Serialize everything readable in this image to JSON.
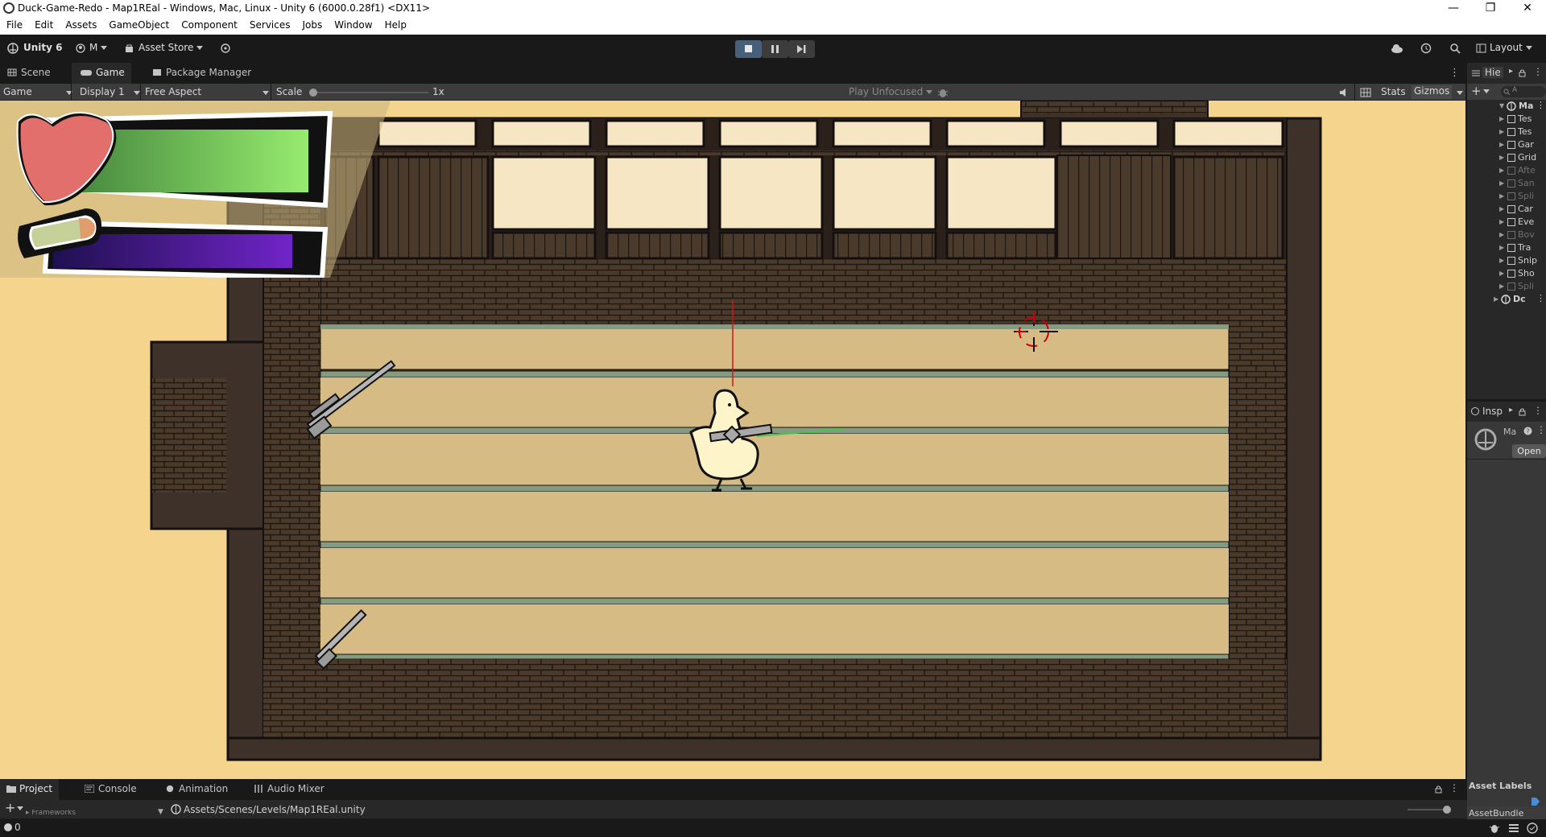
{
  "window": {
    "title": "Duck-Game-Redo - Map1REal - Windows, Mac, Linux - Unity 6 (6000.0.28f1) <DX11>",
    "minimize": "—",
    "maximize": "❐",
    "close": "✕"
  },
  "menu": [
    "File",
    "Edit",
    "Assets",
    "GameObject",
    "Component",
    "Services",
    "Jobs",
    "Window",
    "Help"
  ],
  "toolbar": {
    "unity_label": "Unity 6",
    "account_label": "M",
    "asset_store_label": "Asset Store",
    "layout_label": "Layout"
  },
  "tabs": [
    {
      "label": "Scene"
    },
    {
      "label": "Game"
    },
    {
      "label": "Package Manager"
    }
  ],
  "game_toolbar": {
    "mode": "Game",
    "display": "Display 1",
    "aspect": "Free Aspect",
    "scale_label": "Scale",
    "scale_value": "1x",
    "play_focus": "Play Unfocused",
    "stats": "Stats",
    "gizmos": "Gizmos"
  },
  "hud": {
    "health_fraction": 0.95,
    "ammo_fraction": 0.9,
    "health_color": "#5fbf4e",
    "ammo_color": "#6a1fb0"
  },
  "hierarchy": {
    "tab_label": "Hie",
    "search_placeholder": "A",
    "root": "Ma",
    "items": [
      {
        "name": "Tes",
        "dim": false
      },
      {
        "name": "Tes",
        "dim": false
      },
      {
        "name": "Gar",
        "dim": false
      },
      {
        "name": "Grid",
        "dim": false
      },
      {
        "name": "Afte",
        "dim": true
      },
      {
        "name": "San",
        "dim": true
      },
      {
        "name": "Spli",
        "dim": true
      },
      {
        "name": "Car",
        "dim": false
      },
      {
        "name": "Eve",
        "dim": false
      },
      {
        "name": "Bov",
        "dim": true
      },
      {
        "name": "Tra",
        "dim": false
      },
      {
        "name": "Snip",
        "dim": false
      },
      {
        "name": "Sho",
        "dim": false
      },
      {
        "name": "Spli",
        "dim": true
      }
    ],
    "second_root": "Dc"
  },
  "inspector": {
    "tab_label": "Insp",
    "object_name": "Ma",
    "open_button": "Open",
    "asset_labels": "Asset Labels",
    "asset_bundle": "AssetBundle"
  },
  "bottom_tabs": [
    {
      "label": "Project"
    },
    {
      "label": "Console"
    },
    {
      "label": "Animation"
    },
    {
      "label": "Audio Mixer"
    }
  ],
  "project": {
    "path": "Assets/Scenes/Levels/Map1REal.unity",
    "collapsed_folder": "Frameworks"
  },
  "status": {
    "count": "0"
  },
  "colors": {
    "editor_bg": "#191919",
    "panel_bg": "#282828",
    "toolbar_bg": "#3c3c3c",
    "active_play": "#46607c",
    "game_bg": "#f5d58e"
  }
}
